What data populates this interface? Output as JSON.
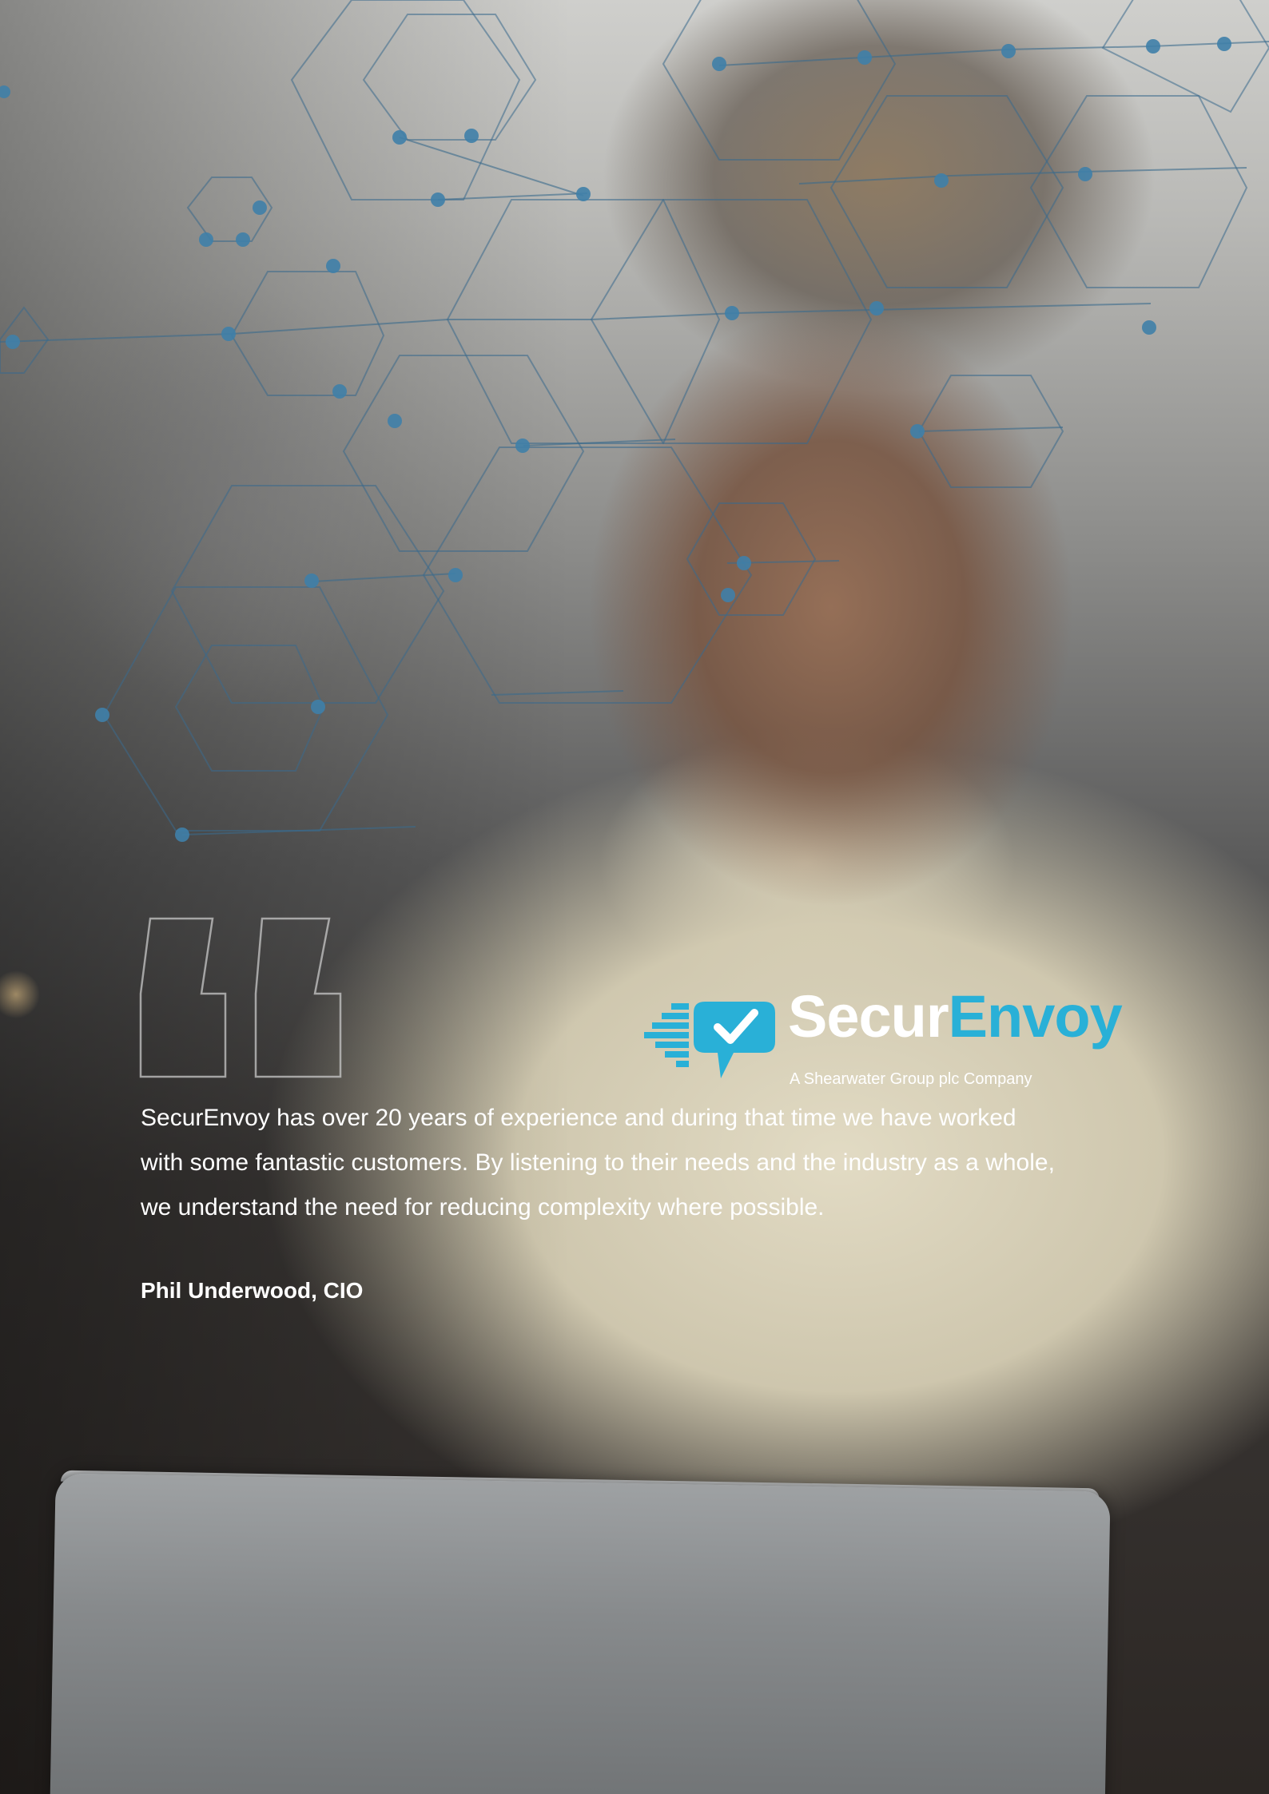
{
  "quote": {
    "text": "SecurEnvoy has over 20 years of experience and during that time we have worked with some fantastic customers. By listening to their needs and the industry as a whole, we understand the need for reducing complexity where possible.",
    "author": "Phil Underwood, CIO"
  },
  "logo": {
    "wordmark_part1": "Secur",
    "wordmark_part2": "Envoy",
    "tagline": "A Shearwater Group plc Company",
    "icon": "speech-bubble-checkmark-icon"
  },
  "colors": {
    "brand_blue": "#29b0d7",
    "text": "#ffffff",
    "network_lines": "#3a6a8c",
    "network_nodes": "#3f7fa8"
  },
  "background": {
    "photo": "woman-using-tablet-photo",
    "overlay": "hexagon-network-pattern",
    "decoration": "quotation-mark-outline-icon"
  }
}
